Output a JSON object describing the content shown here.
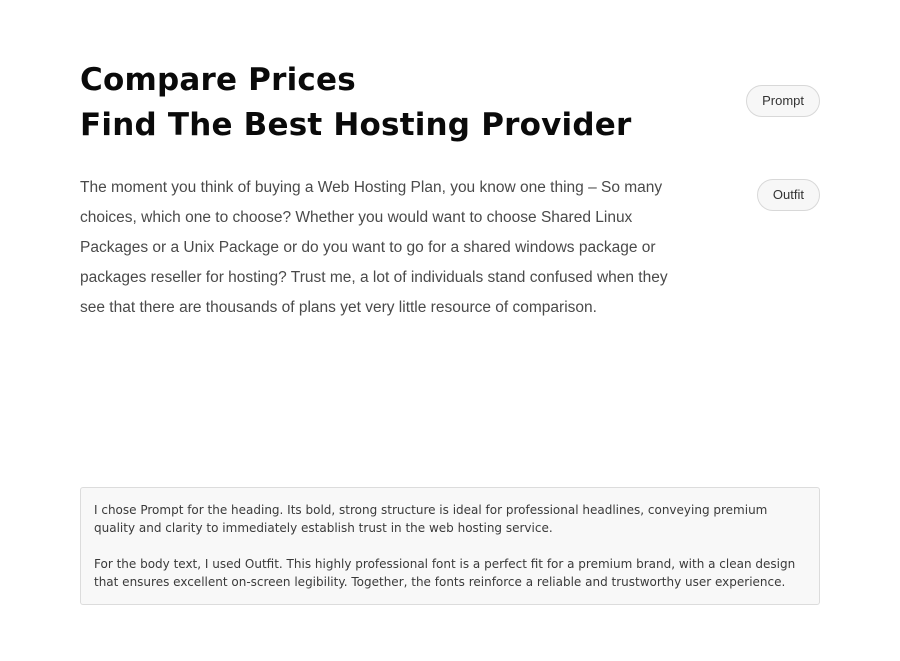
{
  "heading": {
    "line1": "Compare Prices",
    "line2": "Find The Best Hosting Provider"
  },
  "font_pills": {
    "heading_font": "Prompt",
    "body_font": "Outfit"
  },
  "body": {
    "paragraph": "The moment you think of buying a Web Hosting Plan, you know one thing – So many choices, which one to choose? Whether you would want to choose Shared Linux Packages or a Unix Package or do you want to go for a shared windows package or packages reseller for hosting? Trust me, a lot of individuals stand confused when they see that there are thousands of plans yet very little resource of comparison."
  },
  "note": {
    "heading_rationale": "I chose Prompt for the heading. Its bold, strong structure is ideal for professional headlines, conveying premium quality and clarity to immediately establish trust in the web hosting service.",
    "body_rationale": "For the body text, I used Outfit. This highly professional font is a perfect fit for a premium brand, with a clean design that ensures excellent on-screen legibility. Together, the fonts reinforce a reliable and trustworthy user experience."
  }
}
